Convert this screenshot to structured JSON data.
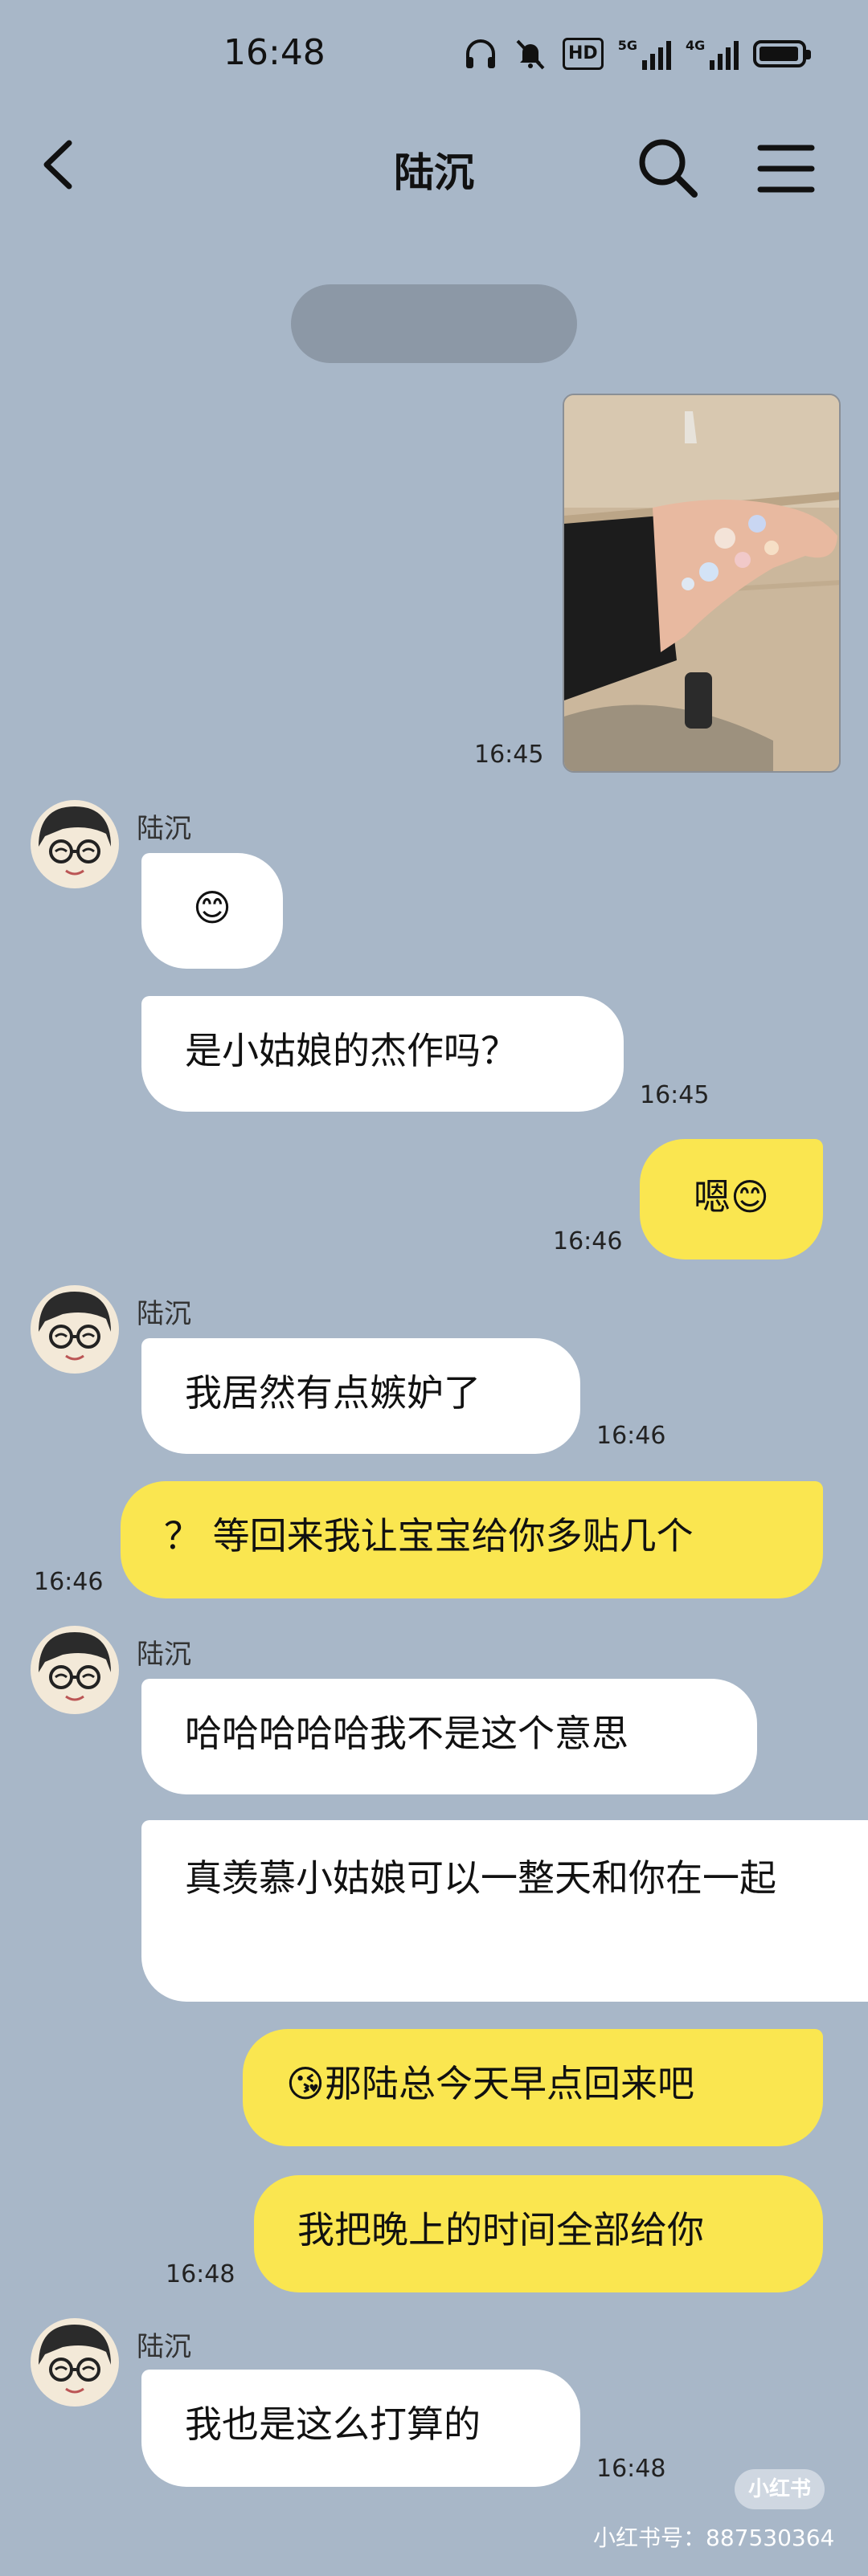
{
  "status_bar": {
    "time": "16:48",
    "icons": [
      "headphones-icon",
      "mute-bell-icon",
      "hd-icon",
      "signal-5g-icon",
      "signal-4g-icon",
      "battery-icon"
    ],
    "hd_text": "HD",
    "sig1_label": "5G",
    "sig2_label": "4G"
  },
  "header": {
    "title": "陆沉",
    "back_icon": "chevron-left-icon",
    "search_icon": "search-icon",
    "menu_icon": "menu-icon"
  },
  "system_pill": "",
  "messages": {
    "photo_time": "16:45",
    "m1_sender": "陆沉",
    "m1_text": "😊",
    "m2_text": "是小姑娘的杰作吗？",
    "m2_time": "16:45",
    "m3_text": "嗯😊",
    "m3_time": "16:46",
    "m4_sender": "陆沉",
    "m4_text": "我居然有点嫉妒了",
    "m4_time": "16:46",
    "m5_text": "？ 等回来我让宝宝给你多贴几个",
    "m5_time": "16:46",
    "m6_sender": "陆沉",
    "m6_text": "哈哈哈哈哈我不是这个意思",
    "m7_text": "真羡慕小姑娘可以一整天和你在一起",
    "m8_text": "😘那陆总今天早点回来吧",
    "m9_text": "我把晚上的时间全部给你",
    "m9_time": "16:48",
    "m10_sender": "陆沉",
    "m10_text": "我也是这么打算的",
    "m10_time": "16:48"
  },
  "watermark": {
    "logo": "小红书",
    "id_text": "小红书号：887530364"
  },
  "colors": {
    "background": "#a8b7c8",
    "incoming_bubble": "#ffffff",
    "outgoing_bubble": "#fae650"
  }
}
